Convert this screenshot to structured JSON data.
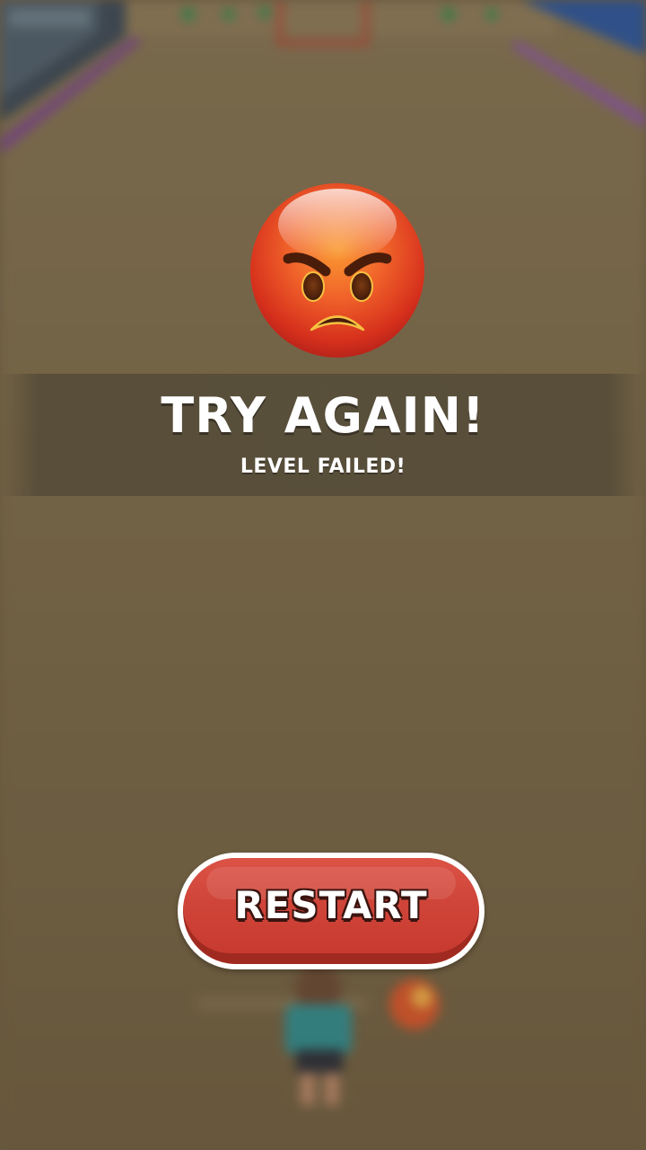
{
  "result": {
    "emoji": "angry-face-icon",
    "title": "TRY AGAIN!",
    "subtitle": "LEVEL FAILED!"
  },
  "actions": {
    "restart_label": "RESTART"
  },
  "colors": {
    "button_red": "#d04539",
    "button_shadow": "#a12a20",
    "button_border": "#ffffff",
    "text": "#ffffff",
    "sand": "#7a6a4c"
  }
}
